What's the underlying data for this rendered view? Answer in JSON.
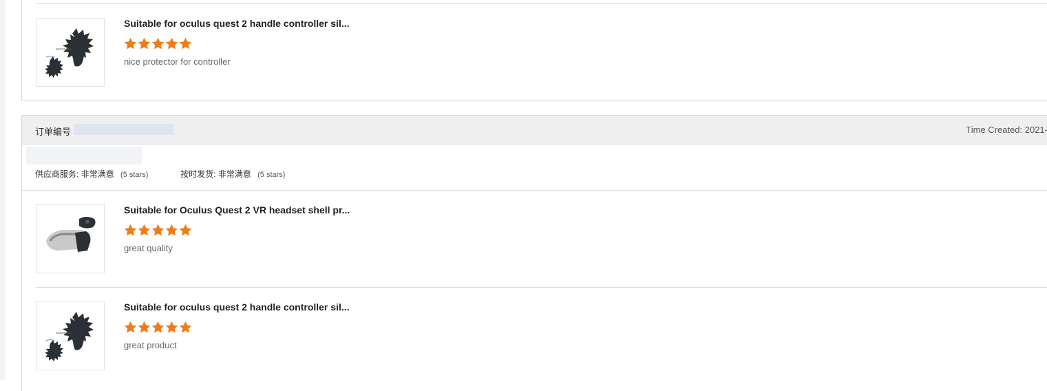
{
  "colors": {
    "star": "#f07b17",
    "header_bg": "#efefef"
  },
  "top_review": {
    "title": "Suitable for oculus quest 2 handle controller sil...",
    "rating": 5,
    "comment": "nice protector for controller",
    "thumb_icon": "controller-cover-icon"
  },
  "order": {
    "label": "订单编号",
    "time_created": "Time Created: 2021-",
    "supplier_label": "供应商服务:",
    "supplier_value": "非常满意",
    "supplier_stars": "(5 stars)",
    "shipping_label": "按时发货:",
    "shipping_value": "非常满意",
    "shipping_stars": "(5 stars)"
  },
  "reviews": [
    {
      "title": "Suitable for Oculus Quest 2 VR headset shell pr...",
      "rating": 5,
      "comment": "great quality",
      "thumb_icon": "headset-shell-icon"
    },
    {
      "title": "Suitable for oculus quest 2 handle controller sil...",
      "rating": 5,
      "comment": "great product",
      "thumb_icon": "controller-cover-icon"
    }
  ]
}
